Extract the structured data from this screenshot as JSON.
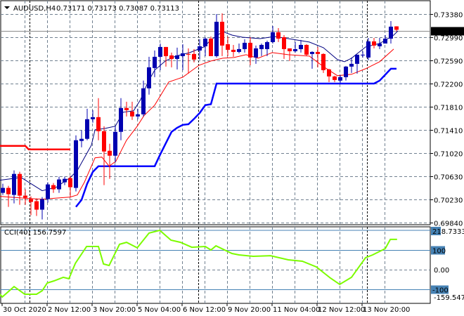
{
  "header": {
    "symbol": "AUDUSD,H4",
    "ohlc": "0.73171 0.73173 0.73087 0.73113",
    "menu_icon": "triangle-down-icon"
  },
  "colors": {
    "bull": "#0000b0",
    "bear": "#ff0000",
    "ma_fast": "#000080",
    "ma_slow": "#ff0000",
    "stop_up": "#0000ff",
    "stop_down": "#ff0000",
    "cci": "#7cfc00",
    "level": "#4682b4",
    "grid": "#708090"
  },
  "chart_data": [
    {
      "type": "candlestick",
      "title": "AUDUSD,H4",
      "last_price": 0.73113,
      "last_price_label": "0.73113",
      "ylim": [
        0.6984,
        0.7338
      ],
      "y_ticks": [
        "0.73380",
        "0.72990",
        "0.72590",
        "0.72200",
        "0.71810",
        "0.71410",
        "0.71020",
        "0.70630",
        "0.70230",
        "0.69840"
      ],
      "y_tick_values": [
        0.7338,
        0.7299,
        0.7259,
        0.722,
        0.7181,
        0.7141,
        0.7102,
        0.7063,
        0.7023,
        0.6984
      ],
      "x_labels": [
        {
          "index": 0,
          "label": "30 Oct 2020"
        },
        {
          "index": 8,
          "label": "2 Nov 12:00"
        },
        {
          "index": 16,
          "label": "3 Nov 20:00"
        },
        {
          "index": 24,
          "label": "5 Nov 04:00"
        },
        {
          "index": 32,
          "label": "6 Nov 12:00"
        },
        {
          "index": 40,
          "label": "9 Nov 20:00"
        },
        {
          "index": 48,
          "label": "11 Nov 04:00"
        },
        {
          "index": 56,
          "label": "12 Nov 12:00"
        },
        {
          "index": 64,
          "label": "13 Nov 20:00"
        }
      ],
      "day_separators": [
        5,
        35,
        65
      ],
      "candles": [
        [
          0.70345,
          0.705,
          0.7031,
          0.70429
        ],
        [
          0.70429,
          0.70464,
          0.70107,
          0.70322
        ],
        [
          0.7031,
          0.70726,
          0.70167,
          0.70666
        ],
        [
          0.70666,
          0.70702,
          0.70143,
          0.70298
        ],
        [
          0.70298,
          0.70405,
          0.70143,
          0.70262
        ],
        [
          0.70238,
          0.70286,
          0.69965,
          0.70191
        ],
        [
          0.70203,
          0.7025,
          0.69953,
          0.7006
        ],
        [
          0.7006,
          0.70274,
          0.69893,
          0.70238
        ],
        [
          0.70238,
          0.70524,
          0.70179,
          0.70488
        ],
        [
          0.70476,
          0.70512,
          0.70345,
          0.70405
        ],
        [
          0.70405,
          0.70619,
          0.70345,
          0.70572
        ],
        [
          0.70524,
          0.70619,
          0.70476,
          0.70583
        ],
        [
          0.70595,
          0.70631,
          0.70274,
          0.70441
        ],
        [
          0.70429,
          0.71321,
          0.70369,
          0.71238
        ],
        [
          0.71226,
          0.71404,
          0.71119,
          0.71262
        ],
        [
          0.71262,
          0.71773,
          0.71238,
          0.71595
        ],
        [
          0.71595,
          0.71749,
          0.71535,
          0.7163
        ],
        [
          0.7163,
          0.71952,
          0.71238,
          0.71392
        ],
        [
          0.71392,
          0.71476,
          0.70476,
          0.71047
        ],
        [
          0.71059,
          0.71178,
          0.70583,
          0.70976
        ],
        [
          0.70976,
          0.71476,
          0.70857,
          0.71381
        ],
        [
          0.71381,
          0.71952,
          0.71238,
          0.71785
        ],
        [
          0.71785,
          0.71892,
          0.71642,
          0.71749
        ],
        [
          0.71725,
          0.71892,
          0.71583,
          0.71642
        ],
        [
          0.71642,
          0.71773,
          0.71595,
          0.71678
        ],
        [
          0.71678,
          0.7225,
          0.71642,
          0.72119
        ],
        [
          0.72119,
          0.72654,
          0.72012,
          0.72476
        ],
        [
          0.72464,
          0.72761,
          0.72309,
          0.72654
        ],
        [
          0.72654,
          0.7288,
          0.72428,
          0.72821
        ],
        [
          0.72821,
          0.72821,
          0.72488,
          0.72666
        ],
        [
          0.72678,
          0.72726,
          0.72476,
          0.72618
        ],
        [
          0.72618,
          0.72809,
          0.7244,
          0.72678
        ],
        [
          0.72666,
          0.72868,
          0.72428,
          0.72714
        ],
        [
          0.72702,
          0.72797,
          0.72369,
          0.7269
        ],
        [
          0.72702,
          0.72785,
          0.72559,
          0.72607
        ],
        [
          0.72761,
          0.72952,
          0.72607,
          0.72833
        ],
        [
          0.72833,
          0.72987,
          0.72666,
          0.72963
        ],
        [
          0.72963,
          0.72999,
          0.72666,
          0.72666
        ],
        [
          0.72666,
          0.7338,
          0.72642,
          0.73249
        ],
        [
          0.73249,
          0.73392,
          0.72666,
          0.72845
        ],
        [
          0.72868,
          0.72999,
          0.72666,
          0.72773
        ],
        [
          0.72773,
          0.72856,
          0.72654,
          0.72737
        ],
        [
          0.72737,
          0.7288,
          0.72714,
          0.72785
        ],
        [
          0.72785,
          0.72952,
          0.72726,
          0.72892
        ],
        [
          0.72892,
          0.72987,
          0.72511,
          0.72642
        ],
        [
          0.72642,
          0.72845,
          0.72535,
          0.72797
        ],
        [
          0.72785,
          0.7288,
          0.72666,
          0.72856
        ],
        [
          0.72785,
          0.72928,
          0.72666,
          0.72904
        ],
        [
          0.72904,
          0.73178,
          0.7288,
          0.73071
        ],
        [
          0.73071,
          0.73142,
          0.72904,
          0.72963
        ],
        [
          0.72987,
          0.73023,
          0.72618,
          0.72785
        ],
        [
          0.72797,
          0.72797,
          0.72583,
          0.72749
        ],
        [
          0.72749,
          0.72904,
          0.72726,
          0.72785
        ],
        [
          0.72785,
          0.7294,
          0.72726,
          0.72856
        ],
        [
          0.72856,
          0.72868,
          0.72666,
          0.7269
        ],
        [
          0.72702,
          0.72749,
          0.72452,
          0.72737
        ],
        [
          0.72737,
          0.72821,
          0.72476,
          0.72702
        ],
        [
          0.72702,
          0.72714,
          0.72381,
          0.72428
        ],
        [
          0.7244,
          0.72452,
          0.72226,
          0.72321
        ],
        [
          0.72321,
          0.72333,
          0.72226,
          0.72261
        ],
        [
          0.7225,
          0.72345,
          0.72214,
          0.72309
        ],
        [
          0.72309,
          0.725,
          0.7225,
          0.72488
        ],
        [
          0.72488,
          0.72642,
          0.72381,
          0.72535
        ],
        [
          0.72535,
          0.7269,
          0.72369,
          0.7269
        ],
        [
          0.72678,
          0.72749,
          0.72642,
          0.7269
        ],
        [
          0.72642,
          0.72975,
          0.72595,
          0.72916
        ],
        [
          0.72916,
          0.72975,
          0.72797,
          0.72845
        ],
        [
          0.72833,
          0.72975,
          0.72785,
          0.7288
        ],
        [
          0.7288,
          0.73023,
          0.7288,
          0.72963
        ],
        [
          0.72963,
          0.73261,
          0.7288,
          0.73166
        ],
        [
          0.73171,
          0.73173,
          0.73087,
          0.73113
        ]
      ],
      "ma_fast": [
        [
          -0.5,
          0.7056
        ],
        [
          3.25,
          0.70607
        ],
        [
          7,
          0.70381
        ],
        [
          9.5,
          0.70441
        ],
        [
          12,
          0.70607
        ],
        [
          13.25,
          0.70726
        ],
        [
          15.75,
          0.71155
        ],
        [
          16.4,
          0.71416
        ],
        [
          18.25,
          0.7144
        ],
        [
          20,
          0.71476
        ],
        [
          21.4,
          0.71714
        ],
        [
          23.25,
          0.71738
        ],
        [
          24.5,
          0.71928
        ],
        [
          25.75,
          0.72214
        ],
        [
          27,
          0.72428
        ],
        [
          28.9,
          0.72583
        ],
        [
          30.75,
          0.72666
        ],
        [
          33.25,
          0.72726
        ],
        [
          35.75,
          0.72821
        ],
        [
          37,
          0.7294
        ],
        [
          39.1,
          0.73083
        ],
        [
          40.75,
          0.73023
        ],
        [
          42.6,
          0.72987
        ],
        [
          45.75,
          0.72963
        ],
        [
          48.25,
          0.72999
        ],
        [
          50.75,
          0.72963
        ],
        [
          54.5,
          0.72904
        ],
        [
          57,
          0.72809
        ],
        [
          59.5,
          0.72607
        ],
        [
          60.75,
          0.72571
        ],
        [
          62,
          0.7263
        ],
        [
          64.5,
          0.72821
        ],
        [
          67,
          0.7288
        ],
        [
          69.5,
          0.73023
        ],
        [
          70.25,
          0.73094
        ]
      ],
      "ma_slow": [
        [
          -0.5,
          0.70286
        ],
        [
          4.5,
          0.7025
        ],
        [
          7,
          0.70238
        ],
        [
          12,
          0.70274
        ],
        [
          13.25,
          0.7031
        ],
        [
          14.5,
          0.70524
        ],
        [
          16.4,
          0.7094
        ],
        [
          17.6,
          0.70952
        ],
        [
          18.9,
          0.70798
        ],
        [
          20.1,
          0.70881
        ],
        [
          22,
          0.71238
        ],
        [
          23.9,
          0.71476
        ],
        [
          25.1,
          0.71655
        ],
        [
          27,
          0.71833
        ],
        [
          29.5,
          0.72226
        ],
        [
          32,
          0.72309
        ],
        [
          34.9,
          0.72511
        ],
        [
          37,
          0.72583
        ],
        [
          39.1,
          0.7263
        ],
        [
          41.1,
          0.72642
        ],
        [
          43.25,
          0.7269
        ],
        [
          45.4,
          0.7263
        ],
        [
          47.9,
          0.72726
        ],
        [
          50.75,
          0.7269
        ],
        [
          54.5,
          0.72666
        ],
        [
          57,
          0.72488
        ],
        [
          59.5,
          0.72333
        ],
        [
          62,
          0.72357
        ],
        [
          64.5,
          0.72452
        ],
        [
          67,
          0.72571
        ],
        [
          69.5,
          0.72785
        ]
      ],
      "stop_down": [
        [
          -0.5,
          0.71142
        ],
        [
          4,
          0.71142
        ],
        [
          4.6,
          0.71083
        ],
        [
          12,
          0.71083
        ]
      ],
      "stop_up": [
        [
          13,
          0.70107
        ],
        [
          14,
          0.70226
        ],
        [
          15,
          0.705
        ],
        [
          16,
          0.70702
        ],
        [
          17,
          0.70797
        ],
        [
          27,
          0.70797
        ],
        [
          28,
          0.71
        ],
        [
          29,
          0.7119
        ],
        [
          30,
          0.7138
        ],
        [
          31,
          0.7145
        ],
        [
          32,
          0.71499
        ],
        [
          33,
          0.7151
        ],
        [
          34,
          0.716
        ],
        [
          35,
          0.717
        ],
        [
          36,
          0.71833
        ],
        [
          37,
          0.7185
        ],
        [
          38,
          0.722
        ],
        [
          66,
          0.722
        ],
        [
          67,
          0.7225
        ],
        [
          68,
          0.7235
        ],
        [
          69,
          0.72452
        ],
        [
          70,
          0.72452
        ]
      ]
    },
    {
      "type": "line",
      "title": "CCI(40)",
      "label": "CCI(40) 156.7597",
      "current_value": 156.7597,
      "max_label": "218.7333",
      "min_label": "-159.5471",
      "ylim": [
        -159.5471,
        218.7333
      ],
      "levels": [
        {
          "value": 100,
          "label": "100"
        },
        {
          "value": -100,
          "label": "-100"
        }
      ],
      "zero_label": "0.00",
      "extra_level": 200,
      "series": [
        [
          -0.5,
          -125
        ],
        [
          -0.1,
          -139
        ],
        [
          2,
          -86
        ],
        [
          3.9,
          -125
        ],
        [
          6,
          -125
        ],
        [
          7,
          -107
        ],
        [
          7.9,
          -68
        ],
        [
          9.1,
          -57
        ],
        [
          10.75,
          -39
        ],
        [
          11.75,
          -46
        ],
        [
          12.9,
          32
        ],
        [
          14.9,
          118
        ],
        [
          17,
          118
        ],
        [
          17.9,
          29
        ],
        [
          18.9,
          21
        ],
        [
          20.75,
          129
        ],
        [
          22,
          139
        ],
        [
          23.9,
          111
        ],
        [
          26,
          186
        ],
        [
          27.9,
          200
        ],
        [
          29.9,
          150
        ],
        [
          31.6,
          139
        ],
        [
          33.6,
          114
        ],
        [
          36,
          118
        ],
        [
          37,
          100
        ],
        [
          37.9,
          121
        ],
        [
          40.75,
          82
        ],
        [
          42,
          75
        ],
        [
          44.5,
          68
        ],
        [
          47.6,
          71
        ],
        [
          50.75,
          50
        ],
        [
          53.25,
          43
        ],
        [
          55.75,
          14
        ],
        [
          58.25,
          -43
        ],
        [
          59.9,
          -75
        ],
        [
          62,
          -39
        ],
        [
          64.5,
          61
        ],
        [
          65.75,
          75
        ],
        [
          68,
          107
        ],
        [
          68.9,
          154
        ],
        [
          70.1,
          154
        ]
      ]
    }
  ]
}
